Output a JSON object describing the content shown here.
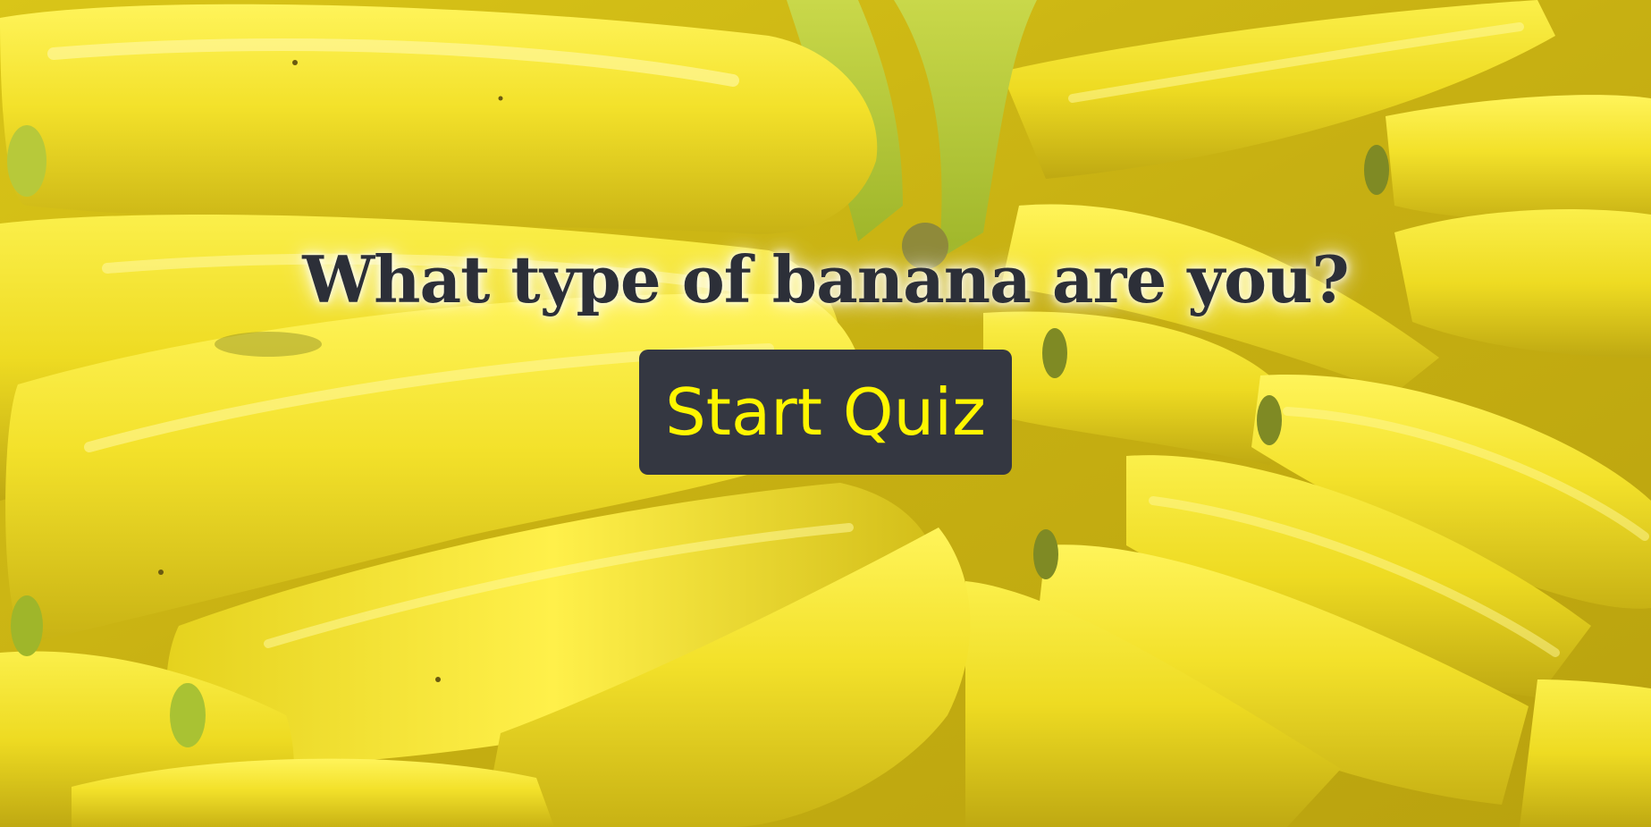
{
  "page": {
    "title": "What type of banana are you?",
    "start_button_label": "Start Quiz"
  },
  "background": {
    "image": "bananas-photo",
    "palette": {
      "banana_yellow": "#f2e12a",
      "highlight_yellow": "#fff24d",
      "shadow_yellow": "#c9b414",
      "stem_green": "#a9c233",
      "deep_shadow": "#8a7a10"
    }
  },
  "colors": {
    "title_text": "#2c2f38",
    "button_bg": "#343741",
    "button_text": "#fff600"
  }
}
